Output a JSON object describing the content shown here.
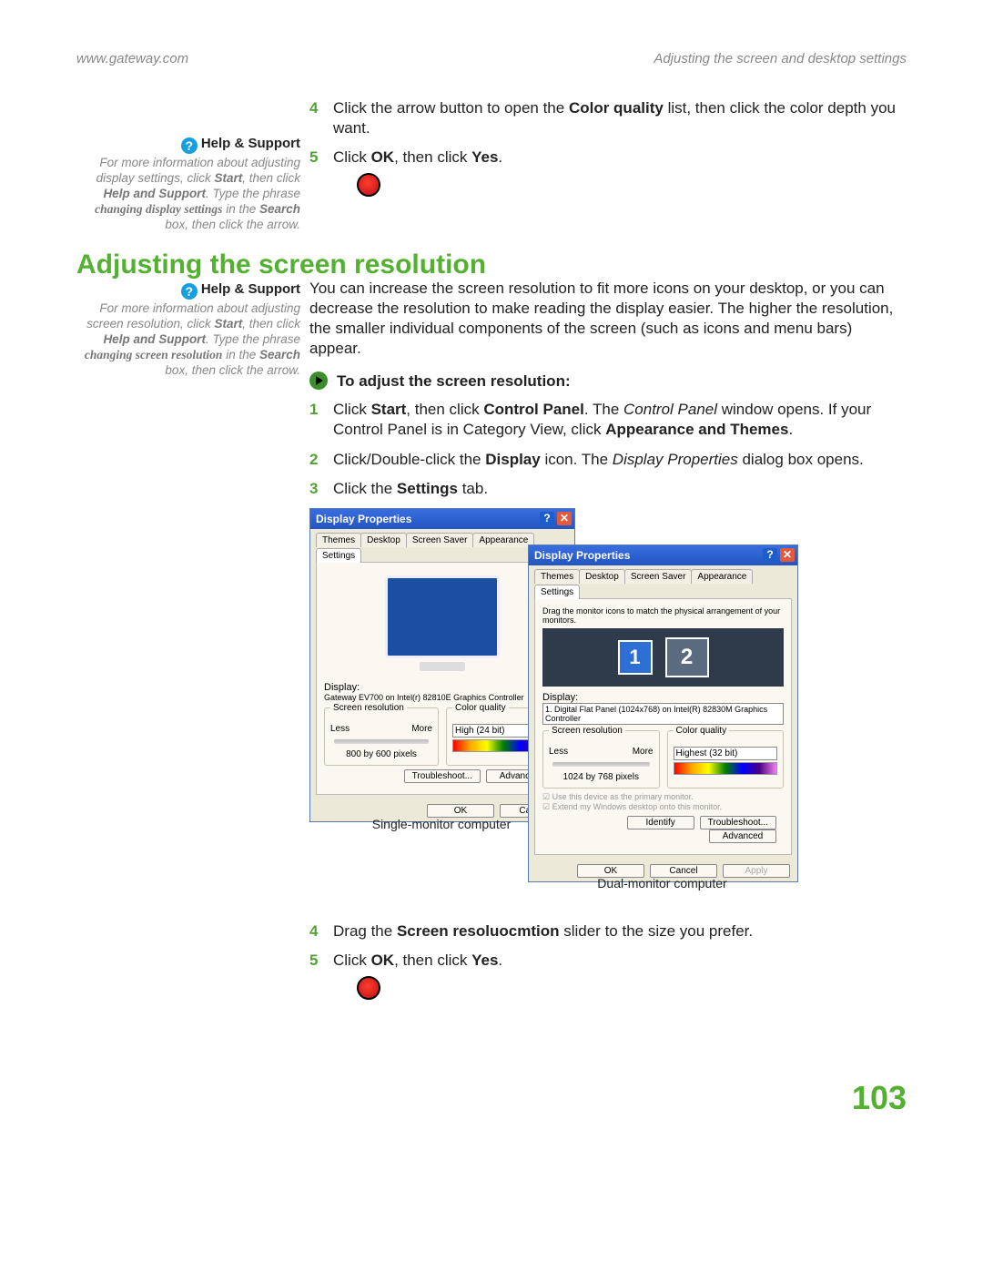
{
  "header": {
    "left": "www.gateway.com",
    "right": "Adjusting the screen and desktop settings"
  },
  "topSteps": {
    "s4": {
      "num": "4",
      "a": "Click the arrow button to open the ",
      "b": "Color quality",
      "c": " list, then click the color depth you want."
    },
    "s5": {
      "num": "5",
      "a": "Click ",
      "b": "OK",
      "c": ", then click ",
      "d": "Yes",
      "e": "."
    }
  },
  "side1": {
    "title": "Help & Support",
    "body": {
      "a": "For more information about adjusting display settings, click ",
      "start": "Start",
      "b": ", then click ",
      "hs": "Help and Support",
      "c": ". Type the phrase ",
      "phrase": "changing display settings",
      "d": " in the ",
      "search": "Search",
      "e": " box, then click the arrow."
    }
  },
  "h2": "Adjusting the screen resolution",
  "side2": {
    "title": "Help & Support",
    "body": {
      "a": "For more information about adjusting screen resolution, click ",
      "start": "Start",
      "b": ", then click ",
      "hs": "Help and Support",
      "c": ". Type the phrase ",
      "phrase": "changing screen resolution",
      "d": " in the ",
      "search": "Search",
      "e": " box, then click the arrow."
    }
  },
  "intro": "You can increase the screen resolution to fit more icons on your desktop, or you can decrease the resolution to make reading the display easier. The higher the resolution, the smaller individual components of the screen (such as icons and menu bars) appear.",
  "procTitle": "To adjust the screen resolution:",
  "steps": {
    "s1": {
      "num": "1",
      "a": "Click ",
      "start": "Start",
      "b": ", then click ",
      "cp": "Control Panel",
      "c": ". The ",
      "cpi": "Control Panel",
      "d": " window opens. If your Control Panel is in Category View, click ",
      "at": "Appearance and Themes",
      "e": "."
    },
    "s2": {
      "num": "2",
      "a": "Click/Double-click the ",
      "disp": "Display",
      "b": " icon. The ",
      "dp": "Display Properties",
      "c": " dialog box opens."
    },
    "s3": {
      "num": "3",
      "a": "Click the ",
      "set": "Settings",
      "b": " tab."
    },
    "s4": {
      "num": "4",
      "a": "Drag the ",
      "sr": "Screen resoluocmtion",
      "b": " slider to the size you prefer."
    },
    "s5": {
      "num": "5",
      "a": "Click ",
      "ok": "OK",
      "b": ", then click ",
      "yes": "Yes",
      "c": "."
    }
  },
  "dlg": {
    "title": "Display Properties",
    "tabs": {
      "themes": "Themes",
      "desktop": "Desktop",
      "ss": "Screen Saver",
      "app": "Appearance",
      "set": "Settings"
    },
    "d1": {
      "displayLabel": "Display:",
      "displayVal": "Gateway EV700 on Intel(r) 82810E Graphics Controller",
      "srLabel": "Screen resolution",
      "less": "Less",
      "more": "More",
      "resVal": "800 by 600 pixels",
      "cqLabel": "Color quality",
      "cqVal": "High (24 bit)",
      "tbl": "Troubleshoot...",
      "adv": "Advanced",
      "ok": "OK",
      "cancel": "Cancel",
      "cap": "Single-monitor computer"
    },
    "d2": {
      "drag": "Drag the monitor icons to match the physical arrangement of your monitors.",
      "displayLabel": "Display:",
      "displayVal": "1. Digital Flat Panel (1024x768) on Intel(R) 82830M Graphics Controller",
      "srLabel": "Screen resolution",
      "less": "Less",
      "more": "More",
      "resVal": "1024 by 768 pixels",
      "cqLabel": "Color quality",
      "cqVal": "Highest (32 bit)",
      "c1": "Use this device as the primary monitor.",
      "c2": "Extend my Windows desktop onto this monitor.",
      "ident": "Identify",
      "tbl": "Troubleshoot...",
      "adv": "Advanced",
      "ok": "OK",
      "cancel": "Cancel",
      "apply": "Apply",
      "cap": "Dual-monitor computer"
    }
  },
  "pageNum": "103"
}
